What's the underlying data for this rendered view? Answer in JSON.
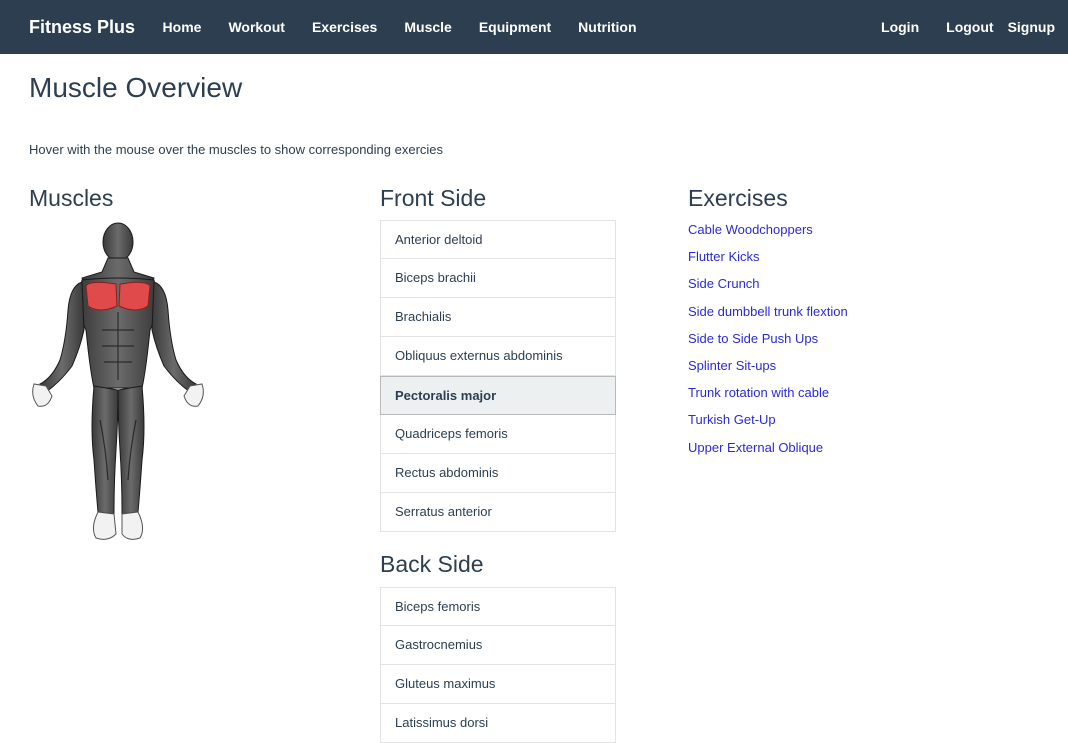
{
  "nav": {
    "brand": "Fitness Plus",
    "left": [
      "Home",
      "Workout",
      "Exercises",
      "Muscle",
      "Equipment",
      "Nutrition"
    ],
    "right": [
      "Login",
      "Logout",
      "Signup"
    ]
  },
  "page": {
    "title": "Muscle Overview",
    "hint": "Hover with the mouse over the muscles to show corresponding exercies"
  },
  "muscles": {
    "heading": "Muscles",
    "highlight_color": "#e04a4a"
  },
  "front": {
    "heading": "Front Side",
    "items": [
      "Anterior deltoid",
      "Biceps brachii",
      "Brachialis",
      "Obliquus externus abdominis",
      "Pectoralis major",
      "Quadriceps femoris",
      "Rectus abdominis",
      "Serratus anterior"
    ],
    "active": "Pectoralis major"
  },
  "back": {
    "heading": "Back Side",
    "items": [
      "Biceps femoris",
      "Gastrocnemius",
      "Gluteus maximus",
      "Latissimus dorsi"
    ]
  },
  "exercises": {
    "heading": "Exercises",
    "items": [
      "Cable Woodchoppers",
      "Flutter Kicks",
      "Side Crunch",
      "Side dumbbell trunk flextion",
      "Side to Side Push Ups",
      "Splinter Sit-ups",
      "Trunk rotation with cable",
      "Turkish Get-Up",
      "Upper External Oblique"
    ]
  }
}
